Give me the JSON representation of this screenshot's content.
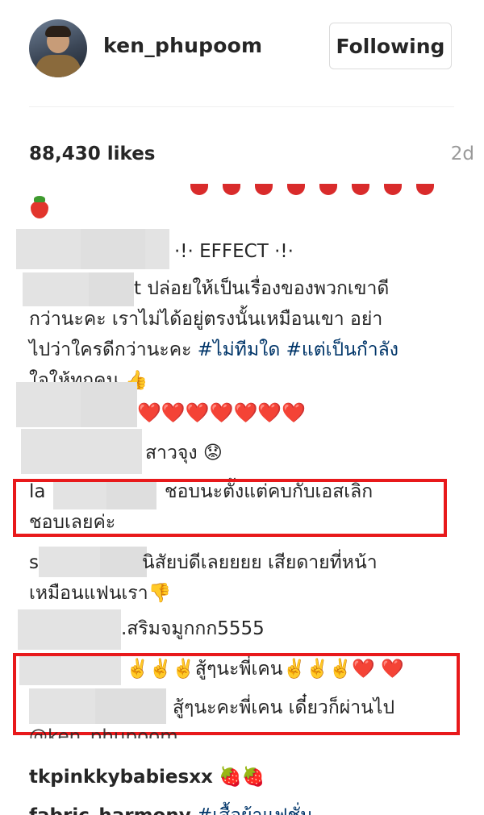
{
  "post": {
    "username": "ken_phupoom",
    "follow_label": "Following",
    "likes": "88,430 likes",
    "age": "2d"
  },
  "comments": [
    {
      "text": "·!· EFFECT ·!·"
    },
    {
      "text_1": "t ปล่อยให้เป็นเรื่องของพวกเขาดี",
      "text_2": "กว่านะคะ เราไม่ได้อยู่ตรงนั้นเหมือนเขา อย่า",
      "text_3a": "ไปว่าใครดีกว่านะคะ ",
      "tag_1": "#ไม่ทีมใด",
      "tag_2": " #แต่เป็นกำลัง",
      "text_4": "ใจให้ทุกคน 👍"
    },
    {
      "text": "❤️❤️❤️❤️❤️❤️❤️"
    },
    {
      "text": "สาวจุง 😟"
    },
    {
      "prefix": "la",
      "text_1": "ชอบนะตั้งแต่คบกับเอสเลิก",
      "text_2": "ชอบเลยค่ะ"
    },
    {
      "prefix": "s",
      "text_1": "นิสัยบ่ดีเลยยยย เสียดายที่หน้า",
      "text_2": "เหมือนแฟนเรา👎"
    },
    {
      "text": ".สริมจมูกกก5555"
    },
    {
      "text": "✌️✌️✌️สู้ๆนะพี่เคน✌️✌️✌️❤️ ❤️"
    },
    {
      "text": "สู้ๆนะคะพี่เคน เดี๋ยวก็ผ่านไป",
      "mention": "@ken_phupoom"
    },
    {
      "user": "tkpinkkybabiesxx",
      "text": "🍓🍓"
    },
    {
      "user": "fabric_harmony",
      "text": "#เสื้อผ้าแฟชั่น"
    }
  ],
  "colors": {
    "highlight": "#e8191b",
    "hashtag": "#003569",
    "muted": "#999999"
  }
}
